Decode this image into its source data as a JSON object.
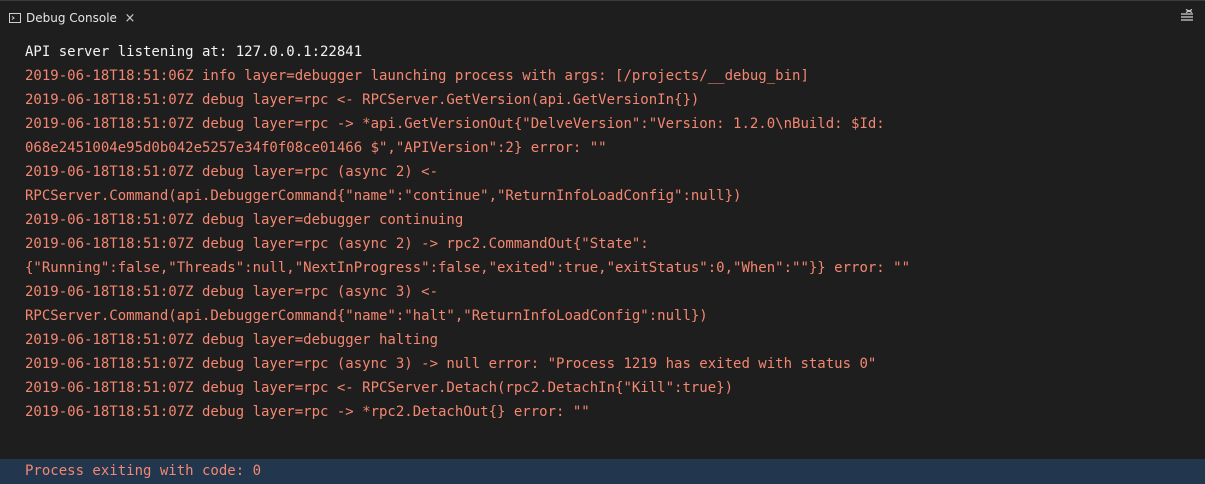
{
  "tab": {
    "label": "Debug Console",
    "icon": "terminal-icon",
    "close_glyph": "×"
  },
  "toolbar": {
    "clear_icon": "clear-console-icon"
  },
  "console": {
    "lines": [
      {
        "kind": "info",
        "text": "API server listening at: 127.0.0.1:22841"
      },
      {
        "kind": "stderr",
        "text": "2019-06-18T18:51:06Z info layer=debugger launching process with args: [/projects/__debug_bin]"
      },
      {
        "kind": "stderr",
        "text": "2019-06-18T18:51:07Z debug layer=rpc <- RPCServer.GetVersion(api.GetVersionIn{})"
      },
      {
        "kind": "stderr",
        "text": "2019-06-18T18:51:07Z debug layer=rpc -> *api.GetVersionOut{\"DelveVersion\":\"Version: 1.2.0\\nBuild: $Id:"
      },
      {
        "kind": "stderr",
        "text": "068e2451004e95d0b042e5257e34f0f08ce01466 $\",\"APIVersion\":2} error: \"\""
      },
      {
        "kind": "stderr",
        "text": "2019-06-18T18:51:07Z debug layer=rpc (async 2) <-"
      },
      {
        "kind": "stderr",
        "text": "RPCServer.Command(api.DebuggerCommand{\"name\":\"continue\",\"ReturnInfoLoadConfig\":null})"
      },
      {
        "kind": "stderr",
        "text": "2019-06-18T18:51:07Z debug layer=debugger continuing"
      },
      {
        "kind": "stderr",
        "text": "2019-06-18T18:51:07Z debug layer=rpc (async 2) -> rpc2.CommandOut{\"State\":"
      },
      {
        "kind": "stderr",
        "text": "{\"Running\":false,\"Threads\":null,\"NextInProgress\":false,\"exited\":true,\"exitStatus\":0,\"When\":\"\"}} error: \"\""
      },
      {
        "kind": "stderr",
        "text": "2019-06-18T18:51:07Z debug layer=rpc (async 3) <-"
      },
      {
        "kind": "stderr",
        "text": "RPCServer.Command(api.DebuggerCommand{\"name\":\"halt\",\"ReturnInfoLoadConfig\":null})"
      },
      {
        "kind": "stderr",
        "text": "2019-06-18T18:51:07Z debug layer=debugger halting"
      },
      {
        "kind": "stderr",
        "text": "2019-06-18T18:51:07Z debug layer=rpc (async 3) -> null error: \"Process 1219 has exited with status 0\""
      },
      {
        "kind": "stderr",
        "text": "2019-06-18T18:51:07Z debug layer=rpc <- RPCServer.Detach(rpc2.DetachIn{\"Kill\":true})"
      },
      {
        "kind": "stderr",
        "text": "2019-06-18T18:51:07Z debug layer=rpc -> *rpc2.DetachOut{} error: \"\""
      }
    ],
    "exit_line": "Process exiting with code: 0"
  },
  "colors": {
    "background": "#1e1e1e",
    "info_text": "#f2f2f2",
    "stderr_text": "#f48771",
    "selected_row": "#22374e"
  }
}
